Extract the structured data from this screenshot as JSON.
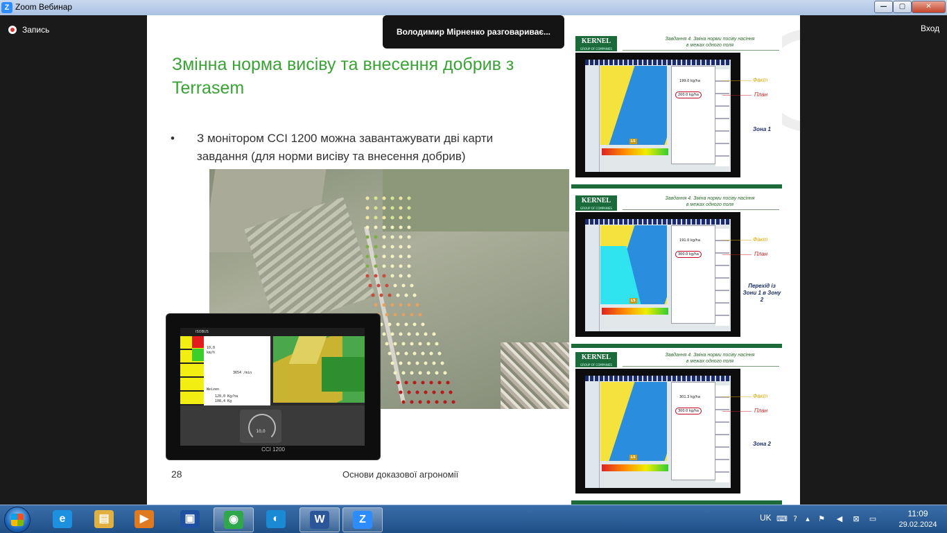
{
  "window": {
    "title": "Zoom Вебинар",
    "app_icon": "Z",
    "minimize": "—",
    "maximize": "▢",
    "close": "✕"
  },
  "zoom": {
    "recording_label": "Запись",
    "exit_label": "Вход",
    "speaker_notice": "Володимир Мірненко разговариває..."
  },
  "slide": {
    "title": "Змінна норма висіву та внесення добрив з Terrasem",
    "bullet_mark": "•",
    "bullet_text": "З монітором CCI 1200 можна завантажувати дві карти завдання (для норми висіву та внесення добрив)",
    "page_number": "28",
    "footer_text": "Основи доказової агрономії",
    "tablet": {
      "brand": "CCI 1200",
      "header": "ISOBUS",
      "speed_value": "10,0",
      "speed_unit": "km/h",
      "area_value": "3654 /min",
      "crop": "Weizen",
      "rate_plan": "120,0 Kg/ha",
      "rate_actual": "108,4 Kg",
      "gauge_value": "10,0"
    }
  },
  "panels": [
    {
      "logo": "KERNEL",
      "logo_sub": "GROUP OF COMPANIES",
      "task_line1": "Завдання 4. Зміна норми посіву насіння",
      "task_line2": "в межах одного поля",
      "fact_label": "Факт",
      "plan_label": "План",
      "fact_value": "199.0 kg/ha",
      "plan_value": "200.0 kg/ha",
      "zone": "Зона 1",
      "lane_badge": "L5"
    },
    {
      "logo": "KERNEL",
      "logo_sub": "GROUP OF COMPANIES",
      "task_line1": "Завдання 4. Зміна норми посіву насіння",
      "task_line2": "в межах одного поля",
      "fact_label": "Факт",
      "plan_label": "План",
      "fact_value": "191.0 kg/ha",
      "plan_value": "300.0 kg/ha",
      "zone": "Перехід із Зони 1 в Зону 2",
      "lane_badge": "L5"
    },
    {
      "logo": "KERNEL",
      "logo_sub": "GROUP OF COMPANIES",
      "task_line1": "Завдання 4. Зміна норми посіву насіння",
      "task_line2": "в межах одного поля",
      "fact_label": "Факт",
      "plan_label": "План",
      "fact_value": "301.3 kg/ha",
      "plan_value": "300.0 kg/ha",
      "zone": "Зона 2",
      "lane_badge": "L5"
    }
  ],
  "taskbar": {
    "items": [
      {
        "name": "ie",
        "glyph": "e",
        "color": "#1e90e0"
      },
      {
        "name": "explorer",
        "glyph": "▤",
        "color": "#e0b040"
      },
      {
        "name": "media-player",
        "glyph": "▶",
        "color": "#e07a20"
      },
      {
        "name": "save",
        "glyph": "▣",
        "color": "#2050a0"
      },
      {
        "name": "chrome",
        "glyph": "◉",
        "color": "#2ea84a"
      },
      {
        "name": "edge",
        "glyph": "◐",
        "color": "#1a8ad4"
      },
      {
        "name": "word",
        "glyph": "W",
        "color": "#2b579a"
      },
      {
        "name": "zoom",
        "glyph": "Z",
        "color": "#2d8cff"
      }
    ],
    "lang": "UK",
    "time": "11:09",
    "date": "29.02.2024"
  }
}
